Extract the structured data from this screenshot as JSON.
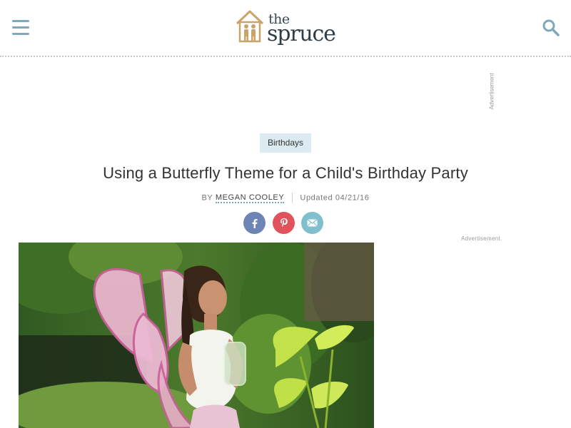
{
  "header": {
    "logo_top": "the",
    "logo_bottom": "spruce",
    "menu_icon": "hamburger-menu-icon",
    "search_icon": "search-icon"
  },
  "ads": {
    "vertical_label": "Advertisement",
    "side_label": "Advertisement"
  },
  "article": {
    "category": "Birthdays",
    "title": "Using a Butterfly Theme for a Child's Birthday Party",
    "by_prefix": "BY",
    "author": "MEGAN COOLEY",
    "updated": "Updated 04/21/16"
  },
  "share": {
    "facebook_icon": "facebook-icon",
    "pinterest_icon": "pinterest-icon",
    "email_icon": "email-icon"
  },
  "colors": {
    "accent": "#7fa9bb",
    "category_bg": "#dcebf1",
    "facebook": "#6d84b4",
    "pinterest": "#e0535b",
    "email": "#80bfcc"
  }
}
